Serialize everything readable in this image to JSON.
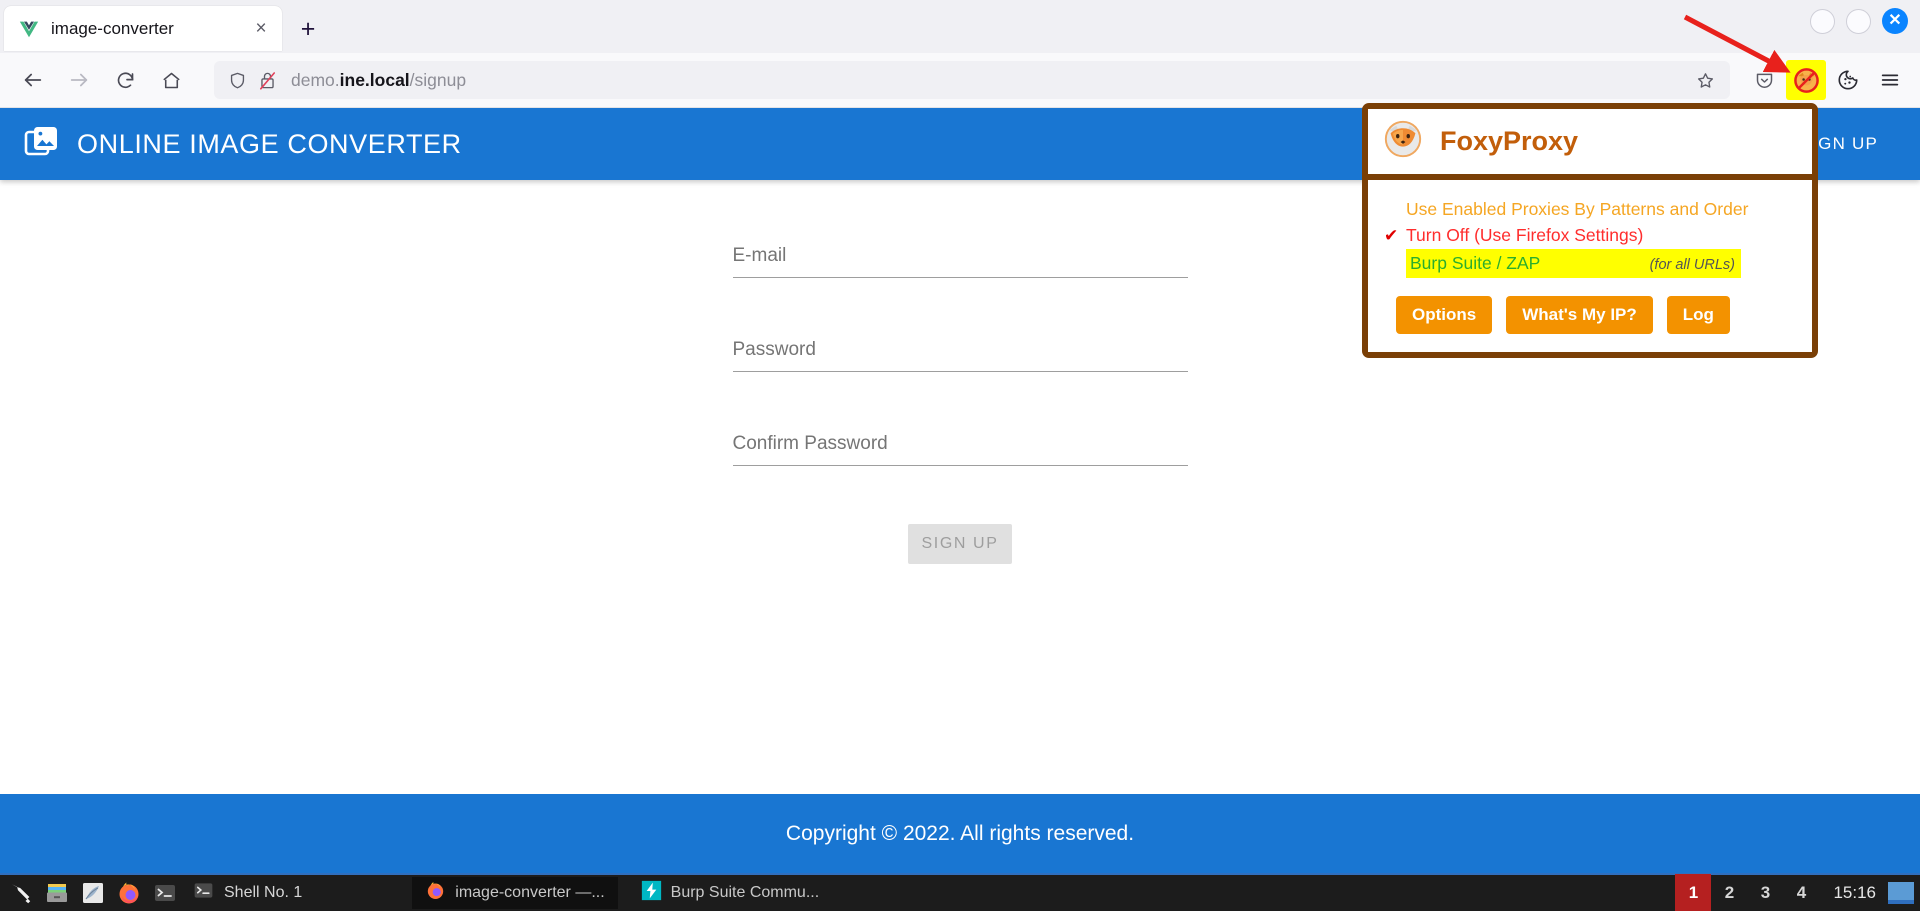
{
  "browser": {
    "tab": {
      "title": "image-converter",
      "favicon": "vue-logo-icon",
      "close_label": "×"
    },
    "new_tab_label": "+",
    "window_controls": {
      "minimize": "minimize-circle",
      "maximize": "maximize-circle",
      "close": "✕"
    },
    "nav": {
      "back": "←",
      "forward": "→",
      "reload": "⟳",
      "home": "⌂"
    },
    "url": {
      "prefix": "demo.",
      "host": "ine.local",
      "path": "/signup",
      "full": "demo.ine.local/signup"
    },
    "toolbar_icons": [
      "shield-icon",
      "broken-lock-icon",
      "bookmark-star-icon",
      "pocket-icon",
      "foxyproxy-icon",
      "cookie-icon",
      "hamburger-menu-icon"
    ]
  },
  "site": {
    "nav": {
      "brand": "ONLINE IMAGE CONVERTER",
      "links": [
        "SIGN UP"
      ],
      "bg_color": "#1976d2"
    },
    "form": {
      "fields": [
        {
          "name": "email",
          "placeholder": "E-mail",
          "value": ""
        },
        {
          "name": "password",
          "placeholder": "Password",
          "value": ""
        },
        {
          "name": "confirm-password",
          "placeholder": "Confirm Password",
          "value": ""
        }
      ],
      "submit_label": "SIGN UP"
    },
    "footer": {
      "text": "Copyright © 2022. All rights reserved."
    }
  },
  "foxyproxy": {
    "title": "FoxyProxy",
    "logo": "fox-head-icon",
    "options": [
      {
        "label": "Use Enabled Proxies By Patterns and Order",
        "color": "#f5a623",
        "checked": false,
        "highlighted": false,
        "note": ""
      },
      {
        "label": "Turn Off (Use Firefox Settings)",
        "color": "#ff2d2d",
        "checked": true,
        "highlighted": false,
        "note": ""
      },
      {
        "label": "Burp Suite / ZAP",
        "color": "#2cae2c",
        "checked": false,
        "highlighted": true,
        "note": "(for all URLs)"
      }
    ],
    "checkmark": "✔",
    "buttons": [
      "Options",
      "What's My IP?",
      "Log"
    ],
    "border_color": "#7a3f06",
    "button_color": "#f39200"
  },
  "taskbar": {
    "launchers": [
      "wrench-icon",
      "file-manager-icon",
      "text-editor-icon",
      "firefox-icon",
      "terminal-icon"
    ],
    "shell_label": "Shell No. 1",
    "windows": [
      {
        "label": "image-converter —...",
        "icon": "firefox-icon",
        "active": true
      },
      {
        "label": "Burp Suite Commu...",
        "icon": "burp-suite-icon",
        "active": false
      }
    ],
    "desktops": [
      "1",
      "2",
      "3",
      "4"
    ],
    "current_desktop": "1",
    "clock": "15:16"
  },
  "annotation": {
    "arrow": "red-arrow-pointing-to-foxyproxy-icon",
    "arrow_color": "#e8211c",
    "highlight_color": "#ffff00"
  }
}
